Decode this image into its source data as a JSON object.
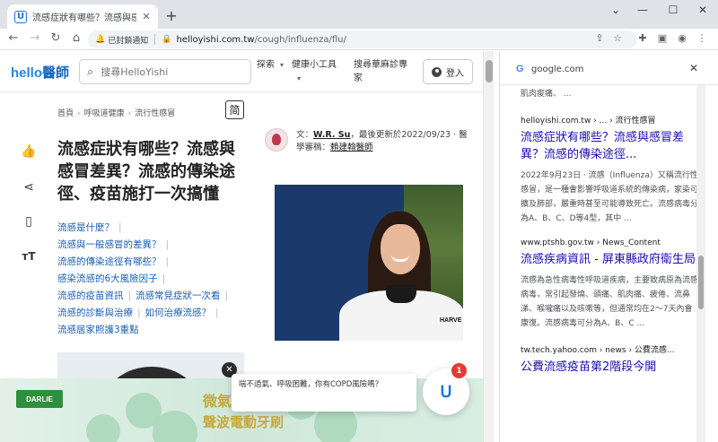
{
  "browser": {
    "tab_title": "流感症狀有哪些？流感與感冒差...",
    "url_host": "helloyishi.com.tw",
    "url_path": "/cough/influenza/flu/",
    "notifications_label": "已封鎖通知",
    "window_controls": [
      "⌄",
      "—",
      "☐",
      "✕"
    ]
  },
  "site": {
    "logo_hello": "hello",
    "logo_brand": "醫師",
    "search_placeholder": "搜尋HelloYishi",
    "nav": [
      {
        "label": "探索"
      },
      {
        "label": "健康小工具"
      },
      {
        "label": "搜尋華麻診專家"
      }
    ],
    "login_label": "登入",
    "simplified_label": "简"
  },
  "breadcrumb": [
    "首頁",
    "呼吸道健康",
    "流行性感冒"
  ],
  "article": {
    "title": "流感症狀有哪些？流感與感冒差異？流感的傳染途徑、疫苗施打一次搞懂",
    "author_prefix": "文：",
    "author_name": "W.R. Su",
    "updated": "，最後更新於2022/09/23 ‧ 醫學審稿：",
    "reviewer": "賴建翰醫師",
    "toc": [
      [
        "流感是什麼？"
      ],
      [
        "流感與一般感冒的差異？"
      ],
      [
        "流感的傳染途徑有哪些？"
      ],
      [
        "感染流感的6大風險因子"
      ],
      [
        "流感的疫苗資訊",
        "流感常見症狀一次看"
      ],
      [
        "流感的診斷與治療",
        "如何治療流感？"
      ],
      [
        "流感居家照護3重點"
      ]
    ],
    "photo_shirt_text": "HARVE"
  },
  "ad": {
    "brand": "DARLIE",
    "line1": "微氣",
    "line2": "聲波電動牙刷"
  },
  "popup": {
    "text": "喘不過氣、呼吸困難，你有COPD風險嗎？",
    "badge": "1"
  },
  "side_panel": {
    "host": "google.com",
    "top_snippet": "肌肉痠痛、 ...",
    "results": [
      {
        "source": "helloyishi.com.tw › ... › 流行性感冒",
        "title": "流感症狀有哪些？流感與感冒差異？流感的傳染途徑...",
        "snippet": "2022年9月23日 · 流感（Influenza）又稱流行性感冒，是一種會影響呼吸道系統的傳染病，家染可擴及肺部，嚴重時甚至可能導致死亡。流感病毒分為A、B、C、D等4型，其中 ..."
      },
      {
        "source": "www.ptshb.gov.tw › News_Content",
        "title": "流感疾病資訊 - 屏東縣政府衛生局",
        "snippet": "流感為急性病毒性呼吸道疾病，主要致病原為流感病毒，常引起發燒、頭痛、肌肉痛、疲倦、流鼻涕、喉嚨痛以及咳嗽等，但通常均在2～7天內會康復。流感病毒可分為A、B、C ..."
      },
      {
        "source": "tw.tech.yahoo.com › news › 公費流感...",
        "title": "公費流感疫苗第2階段今開",
        "snippet": ""
      }
    ]
  },
  "colors": {
    "link": "#1a0dab",
    "toc_link": "#1a5fb4",
    "brand_blue": "#1565c0"
  }
}
